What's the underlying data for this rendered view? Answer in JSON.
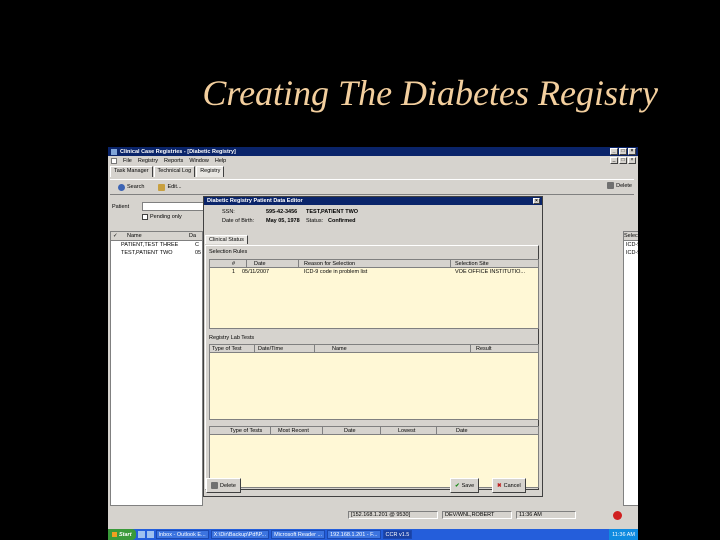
{
  "slide": {
    "title": "Creating The Diabetes Registry"
  },
  "window": {
    "title": "Clinical Case Registries - [Diabetic Registry]",
    "controls": {
      "min": "_",
      "max": "□",
      "close": "×"
    },
    "menu": [
      "File",
      "Registry",
      "Reports",
      "Window",
      "Help"
    ],
    "tabs": [
      "Task Manager",
      "Technical Log",
      "Registry"
    ],
    "toolbar": {
      "search": "Search",
      "edit": "Edit...",
      "delete": "Delete"
    },
    "patient_label": "Patient",
    "pending_label": "Pending only",
    "list": {
      "check_col": "✓",
      "name_col": "Name",
      "da_col": "Da",
      "rows": [
        "PATIENT,TEST THREE",
        "TEST,PATIENT TWO"
      ],
      "row_stubs": [
        "C",
        "05"
      ]
    },
    "right_list": {
      "header": "Selection Rule",
      "rows": [
        "ICD-9 code in problem list",
        "ICD-9 code in problem list"
      ]
    },
    "status": {
      "server": "[152.168.1.201 @ 9530]",
      "user": "DEV/WNL,ROBERT",
      "time": "11:36 AM"
    }
  },
  "dialog": {
    "title": "Diabetic Registry Patient Data Editor",
    "close": "×",
    "ssn_label": "SSN:",
    "ssn": "595-42-3456",
    "name": "TEST,PATIENT TWO",
    "dob_label": "Date of Birth:",
    "dob": "May 05, 1978",
    "status_label": "Status:",
    "status": "Confirmed",
    "tab": "Clinical Status",
    "selection_group": "Selection Rules",
    "selection_cols": [
      "#",
      "Date",
      "Reason for Selection",
      "Selection Site"
    ],
    "selection_rows": [
      {
        "num": "1",
        "date": "05/11/2007",
        "reason": "ICD-9 code in problem list",
        "site": "VOE OFFICE INSTITUTIO..."
      }
    ],
    "lab_group": "Registry Lab Tests",
    "lab_cols": [
      "Type of Test",
      "Date/Time",
      "Name",
      "Result"
    ],
    "tests_cols": [
      "Type of Tests",
      "Most Recent",
      "Date",
      "Lowest",
      "Date"
    ],
    "buttons": {
      "delete": "Delete",
      "save": "Save",
      "cancel": "Cancel"
    }
  },
  "taskbar": {
    "start": "Start",
    "tasks": [
      "Inbox - Outlook E...",
      "X:\\Dir\\Backup\\Pdf\\P...",
      "Microsoft Reader ...",
      "192.168.1.201 - F...",
      "CCR v1.5"
    ],
    "clock": "11:36 AM"
  }
}
